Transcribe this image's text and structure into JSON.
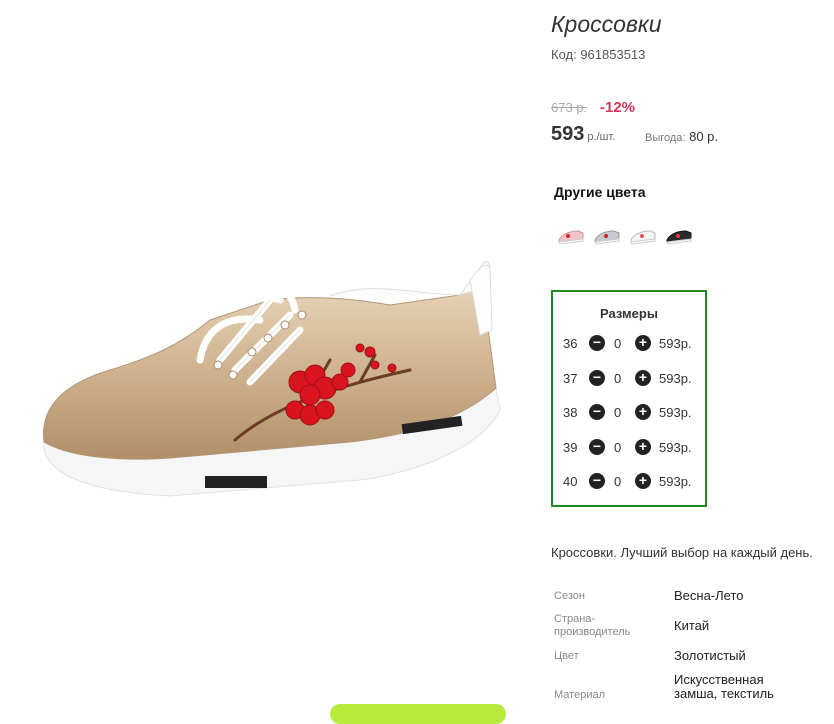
{
  "product": {
    "title": "Кроссовки",
    "code": "Код: 961853513",
    "image_icon": "sneaker-image"
  },
  "pricing": {
    "old_price": "673 р.",
    "discount": "-12%",
    "price": "593",
    "price_unit": "р./шт.",
    "benefit_label": "Выгода:",
    "benefit_value": "80 р.",
    "discount_color": "#e0305a"
  },
  "other_colors": {
    "title": "Другие цвета",
    "swatches": [
      {
        "name": "pink-white-sneaker"
      },
      {
        "name": "silver-sneaker"
      },
      {
        "name": "white-sneaker"
      },
      {
        "name": "black-floral-sneaker"
      }
    ]
  },
  "sizes": {
    "title": "Размеры",
    "border_color": "#1c8a1c",
    "minus_icon": "minus-circle-icon",
    "plus_icon": "plus-circle-icon",
    "rows": [
      {
        "size": "36",
        "qty": "0",
        "price": "593р."
      },
      {
        "size": "37",
        "qty": "0",
        "price": "593р."
      },
      {
        "size": "38",
        "qty": "0",
        "price": "593р."
      },
      {
        "size": "39",
        "qty": "0",
        "price": "593р."
      },
      {
        "size": "40",
        "qty": "0",
        "price": "593р."
      }
    ]
  },
  "description": "Кроссовки. Лучший выбор на каждый день.",
  "specs": [
    {
      "label": "Сезон",
      "value": "Весна-Лето"
    },
    {
      "label": "Страна-производитель",
      "value": "Китай"
    },
    {
      "label": "Цвет",
      "value": "Золотистый"
    },
    {
      "label": "Материал",
      "value": "Искусственная замша, текстиль"
    }
  ],
  "cta": {
    "color": "#b6ea3d"
  }
}
